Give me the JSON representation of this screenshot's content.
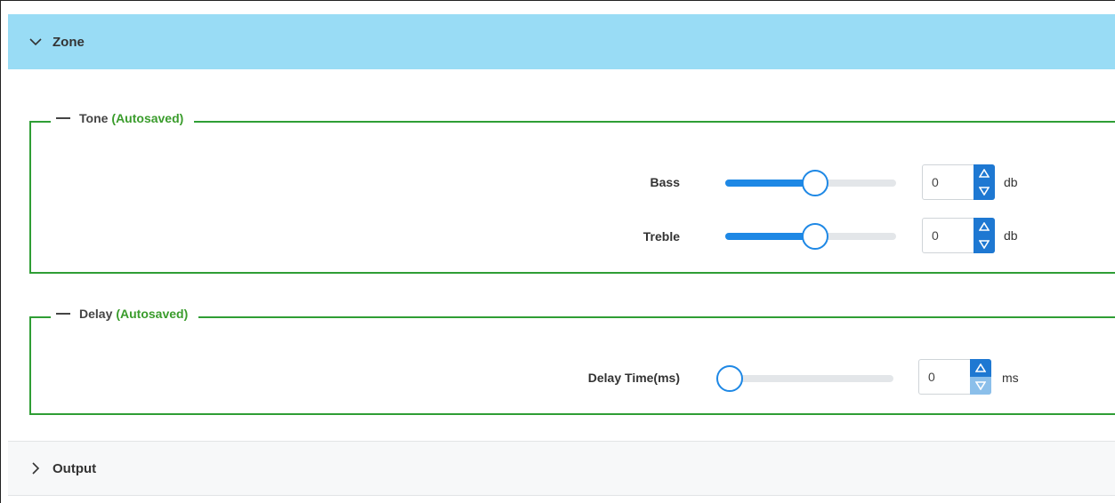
{
  "zone": {
    "title": "Zone",
    "expanded": true
  },
  "tone": {
    "legend": "Tone",
    "status": "(Autosaved)",
    "bass": {
      "label": "Bass",
      "value": "0",
      "unit": "db",
      "level": 0.5
    },
    "treble": {
      "label": "Treble",
      "value": "0",
      "unit": "db",
      "level": 0.5
    }
  },
  "delay": {
    "legend": "Delay",
    "status": "(Autosaved)",
    "time": {
      "label": "Delay Time(ms)",
      "value": "0",
      "unit": "ms",
      "level": 0.0
    }
  },
  "output": {
    "title": "Output",
    "expanded": false
  },
  "colors": {
    "header": "#99dcf5",
    "accent": "#1e88e5",
    "fieldset": "#2f9e35",
    "autosaved": "#3a9c2c"
  },
  "icons": {
    "zone_toggle": "chevron-down-icon",
    "output_toggle": "chevron-right-icon",
    "spin_up": "triangle-up-icon",
    "spin_down": "triangle-down-icon"
  }
}
